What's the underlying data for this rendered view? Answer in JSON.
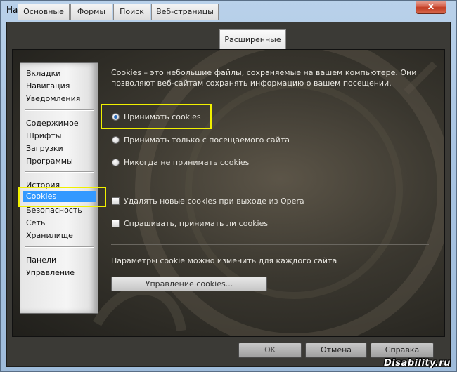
{
  "window": {
    "title": "Настройки",
    "close_glyph": "x"
  },
  "tabs": [
    {
      "label": "Основные",
      "active": false
    },
    {
      "label": "Формы",
      "active": false
    },
    {
      "label": "Поиск",
      "active": false
    },
    {
      "label": "Веб-страницы",
      "active": false
    },
    {
      "label": "Расширенные",
      "active": true
    }
  ],
  "sidebar": {
    "groups": [
      [
        "Вкладки",
        "Навигация",
        "Уведомления"
      ],
      [
        "Содержимое",
        "Шрифты",
        "Загрузки",
        "Программы"
      ],
      [
        "История",
        "Cookies",
        "Безопасность",
        "Сеть",
        "Хранилище"
      ],
      [
        "Панели",
        "Управление"
      ]
    ],
    "selected": "Cookies"
  },
  "content": {
    "description": "Cookies – это небольшие файлы, сохраняемые на вашем компьютере. Они позволяют веб-сайтам сохранять информацию о вашем посещении.",
    "radios": [
      {
        "label": "Принимать cookies",
        "checked": true
      },
      {
        "label": "Принимать только с посещаемого сайта",
        "checked": false
      },
      {
        "label": "Никогда не принимать cookies",
        "checked": false
      }
    ],
    "checkboxes": [
      {
        "label": "Удалять новые cookies при выходе из Opera",
        "checked": false
      },
      {
        "label": "Спрашивать, принимать ли cookies",
        "checked": false
      }
    ],
    "per_site_text": "Параметры cookie можно изменить для каждого сайта",
    "manage_button": "Управление cookies..."
  },
  "footer": {
    "ok": "OK",
    "cancel": "Отмена",
    "help": "Справка"
  },
  "watermark": "Disability.ru",
  "colors": {
    "highlight": "#f0f000",
    "selection": "#3399ff",
    "close": "#c03b22"
  }
}
